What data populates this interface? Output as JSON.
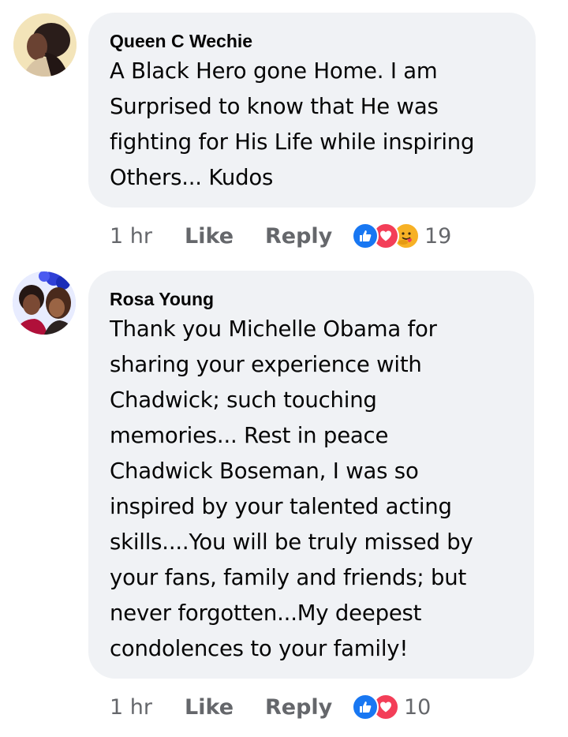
{
  "comments": [
    {
      "author": "Queen C Wechie",
      "lines": [
        "A Black Hero gone Home. I am",
        "Surprised to know that He was",
        "fighting for His Life while inspiring",
        "Others... Kudos"
      ],
      "time": "1 hr",
      "like_label": "Like",
      "reply_label": "Reply",
      "reactions": [
        "like-icon",
        "love-icon",
        "care-icon"
      ],
      "reaction_count": "19"
    },
    {
      "author": "Rosa Young",
      "lines": [
        "Thank you Michelle Obama for",
        "sharing your experience with",
        "Chadwick; such touching",
        "memories... Rest in peace",
        "Chadwick Boseman, I was so",
        "inspired by your talented acting",
        "skills....You will be truly missed by",
        "your fans, family and friends; but",
        "never forgotten...My deepest",
        "condolences to your family!"
      ],
      "time": "1 hr",
      "like_label": "Like",
      "reply_label": "Reply",
      "reactions": [
        "like-icon",
        "love-icon"
      ],
      "reaction_count": "10"
    }
  ],
  "colors": {
    "bubble": "#f0f2f5",
    "text": "#050505",
    "meta": "#65676b",
    "like_blue": "#1877f2",
    "love_red": "#f33e58",
    "care_yellow": "#f7b125"
  }
}
